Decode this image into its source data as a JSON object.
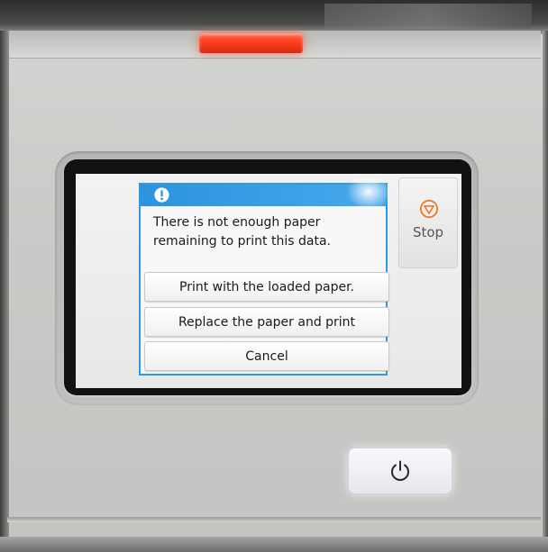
{
  "device": {
    "alarm_light_color": "#ff3d1f",
    "power_icon": "power-icon"
  },
  "dialog": {
    "header_color": "#2e9be0",
    "icon": "info-icon",
    "message": "There is not enough paper\nremaining to print this data.",
    "buttons": [
      {
        "label": "Print with the loaded paper."
      },
      {
        "label": "Replace the paper and print"
      },
      {
        "label": "Cancel"
      }
    ]
  },
  "stop_button": {
    "label": "Stop",
    "icon": "stop-icon",
    "icon_color": "#f07a2c"
  }
}
